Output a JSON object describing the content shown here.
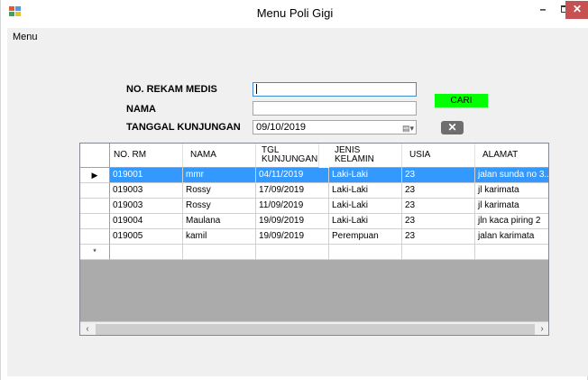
{
  "window": {
    "title": "Menu Poli Gigi"
  },
  "titlebar_buttons": {
    "minimize": "–",
    "close": "✕"
  },
  "menubar": {
    "items": [
      "Menu"
    ]
  },
  "form": {
    "no_rekam_medis_label": "NO. REKAM MEDIS",
    "no_rekam_medis_value": "",
    "nama_label": "NAMA",
    "nama_value": "",
    "tanggal_label": "TANGGAL KUNJUNGAN",
    "tanggal_value": "09/10/2019",
    "cari_label": "CARI",
    "clear_label": "✕"
  },
  "grid": {
    "columns": [
      "NO. RM",
      "NAMA",
      "TGL KUNJUNGAN",
      "JENIS KELAMIN",
      "USIA",
      "ALAMAT"
    ],
    "rows": [
      {
        "no_rm": "019001",
        "nama": "mmr",
        "tgl": "04/11/2019",
        "jk": "Laki-Laki",
        "usia": "23",
        "alamat": "jalan sunda no 3..",
        "selected": true
      },
      {
        "no_rm": "019003",
        "nama": "Rossy",
        "tgl": "17/09/2019",
        "jk": "Laki-Laki",
        "usia": "23",
        "alamat": "jl karimata"
      },
      {
        "no_rm": "019003",
        "nama": "Rossy",
        "tgl": "11/09/2019",
        "jk": "Laki-Laki",
        "usia": "23",
        "alamat": "jl karimata"
      },
      {
        "no_rm": "019004",
        "nama": "Maulana",
        "tgl": "19/09/2019",
        "jk": "Laki-Laki",
        "usia": "23",
        "alamat": "jln kaca piring 2"
      },
      {
        "no_rm": "019005",
        "nama": "kamil",
        "tgl": "19/09/2019",
        "jk": "Perempuan",
        "usia": "23",
        "alamat": "jalan karimata"
      }
    ],
    "current_row_marker": "▶",
    "new_row_marker": "*",
    "scroll_left": "‹",
    "scroll_right": "›"
  },
  "colors": {
    "accent_select": "#3399ff",
    "cari_button": "#00ff00",
    "close_button": "#c75050"
  }
}
